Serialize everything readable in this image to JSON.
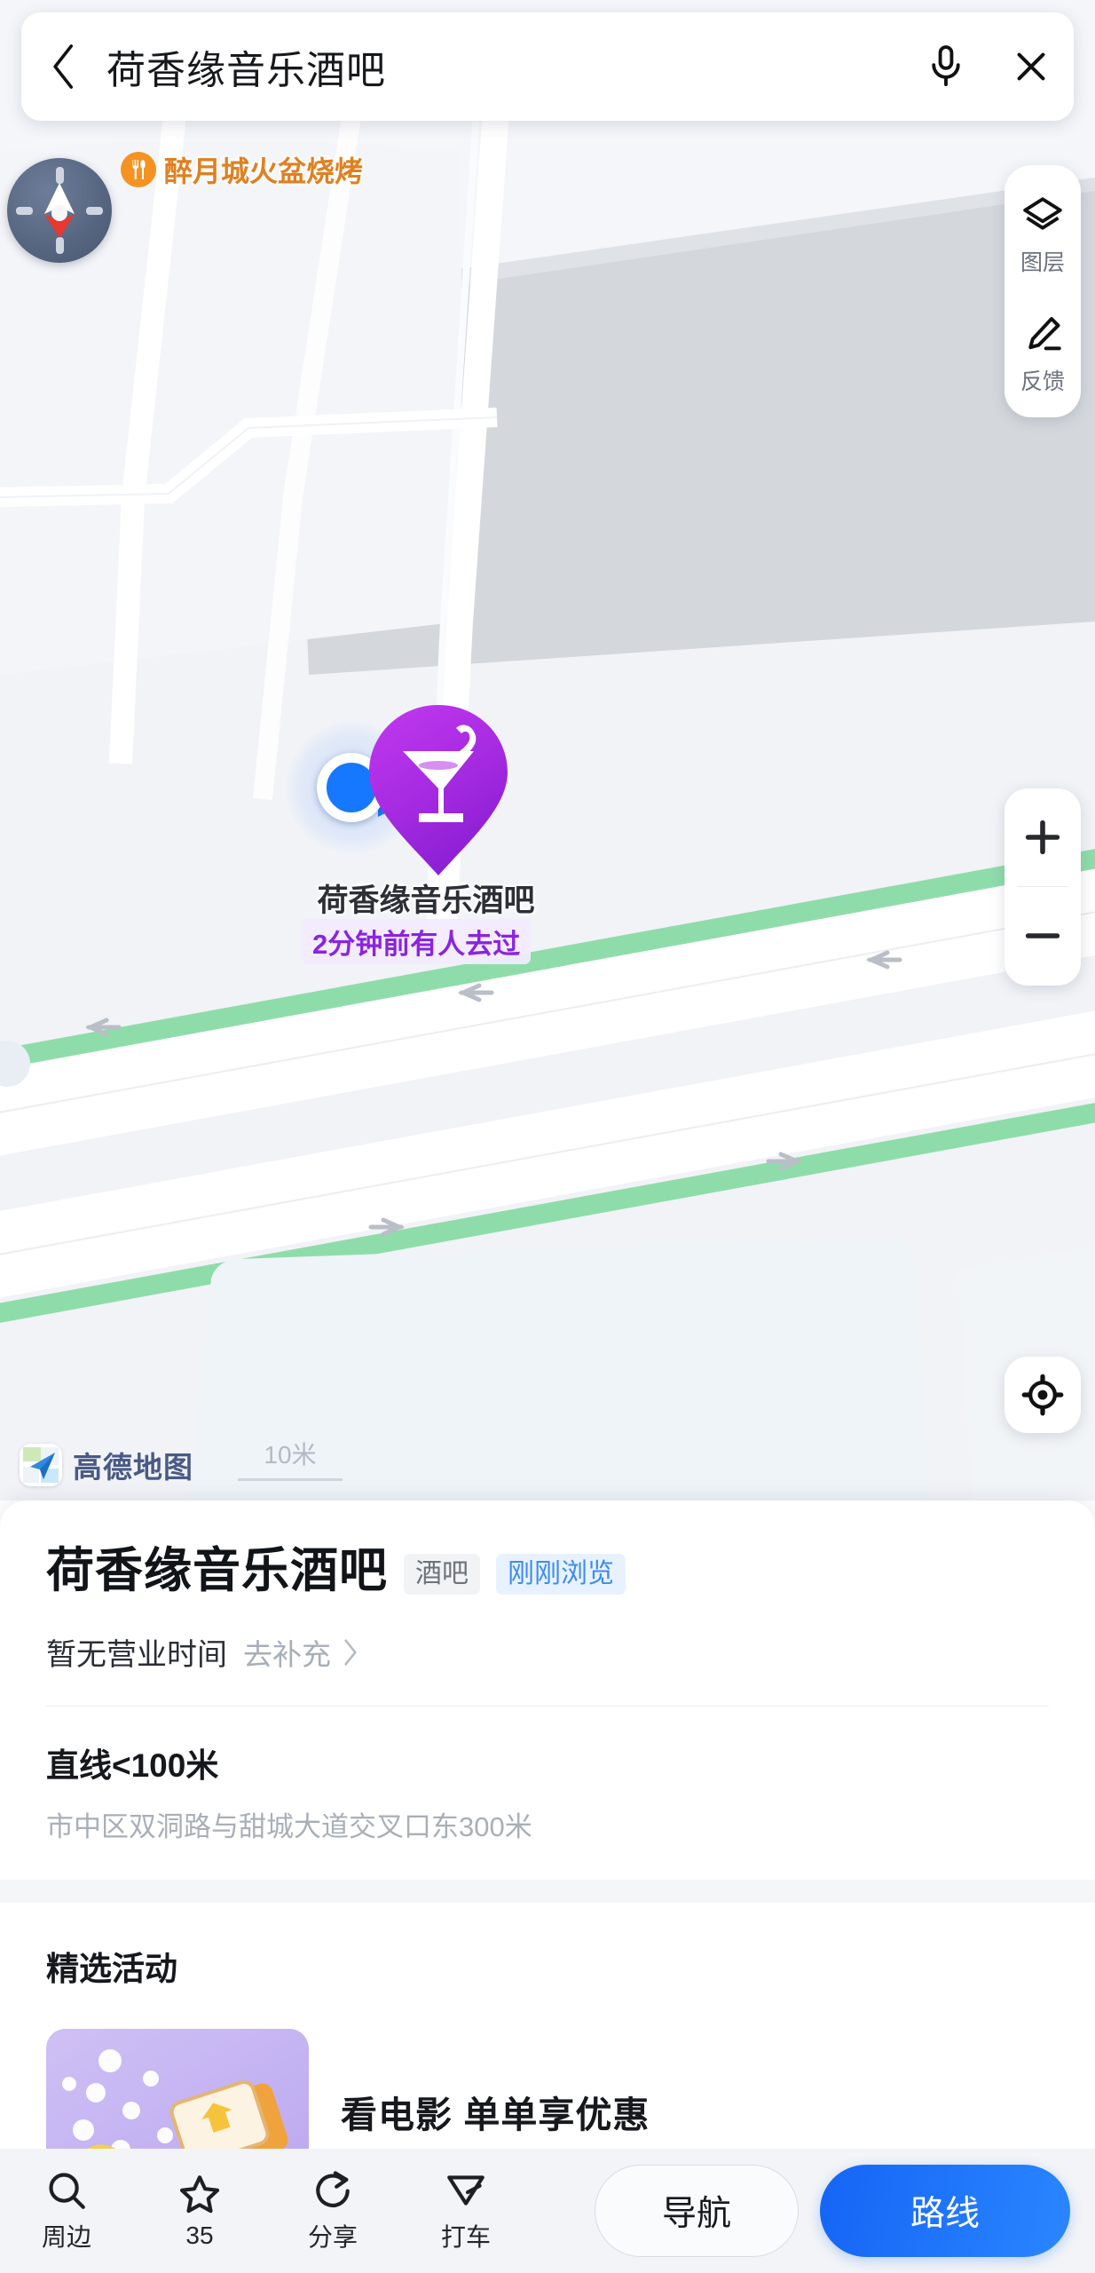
{
  "search": {
    "query": "荷香缘音乐酒吧",
    "back_icon": "chevron-left-icon",
    "mic_icon": "microphone-icon",
    "clear_icon": "close-icon"
  },
  "map": {
    "compass": "compass-icon",
    "nearby_poi": {
      "name": "醉月城火盆烧烤",
      "icon": "restaurant-icon"
    },
    "side_panel": [
      {
        "label": "图层",
        "icon": "layers-icon"
      },
      {
        "label": "反馈",
        "icon": "feedback-pencil-icon"
      }
    ],
    "zoom_in": "+",
    "zoom_out": "−",
    "locate_icon": "crosshair-locate-icon",
    "marker": {
      "icon": "cocktail-icon",
      "name": "荷香缘音乐酒吧",
      "badge": "2分钟前有人去过"
    },
    "attribution": "高德地图",
    "scale": "10米"
  },
  "sheet": {
    "place_name": "荷香缘音乐酒吧",
    "chips": [
      {
        "text": "酒吧",
        "style": "cat"
      },
      {
        "text": "刚刚浏览",
        "style": "recent"
      }
    ],
    "hours": "暂无营业时间",
    "supplement": "去补充",
    "supplement_icon": "chevron-right-icon",
    "distance": "直线<100米",
    "address": "市中区双洞路与甜城大道交叉口东300米",
    "promo_heading": "精选活动",
    "promo_title": "看电影 单单享优惠"
  },
  "toolbar": {
    "items": [
      {
        "label": "周边",
        "icon": "search-icon"
      },
      {
        "label": "35",
        "icon": "star-icon"
      },
      {
        "label": "分享",
        "icon": "share-icon"
      },
      {
        "label": "打车",
        "icon": "taxi-icon"
      }
    ],
    "nav_label": "导航",
    "route_label": "路线"
  },
  "colors": {
    "accent_blue": "#1677ff",
    "marker_purple": "#a42ae0",
    "poi_orange": "#e08020",
    "bike_lane_green": "#8fdcab"
  }
}
